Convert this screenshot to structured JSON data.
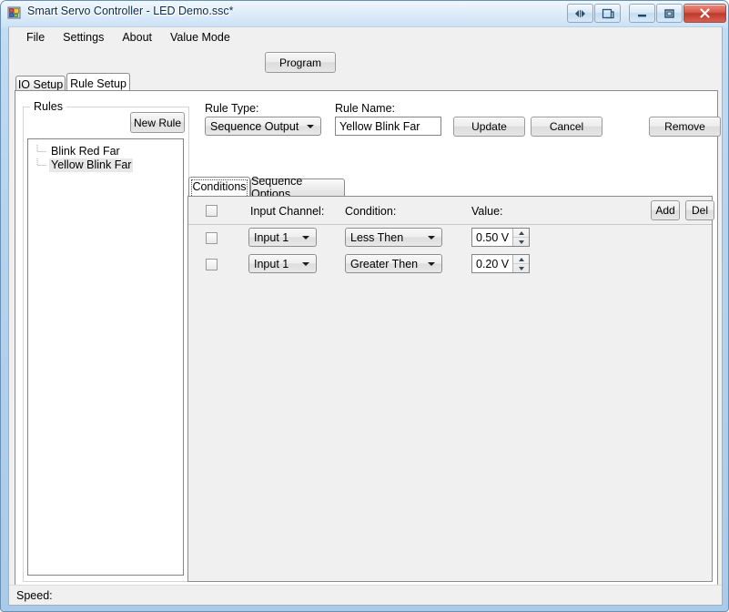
{
  "window": {
    "title": "Smart Servo Controller - LED Demo.ssc*",
    "icon": "app-squares-icon",
    "controls": {
      "nav": "nav-arrows-icon",
      "restore_prev": "restore-window-icon",
      "minimize": "minimize-icon",
      "maximize": "maximize-icon",
      "close": "close-icon"
    }
  },
  "menu": {
    "items": [
      {
        "label": "File"
      },
      {
        "label": "Settings"
      },
      {
        "label": "About"
      },
      {
        "label": "Value Mode"
      }
    ]
  },
  "toolbar": {
    "program_label": "Program"
  },
  "tabs": [
    {
      "label": "IO Setup",
      "active": false
    },
    {
      "label": "Rule Setup",
      "active": true
    }
  ],
  "rules_group": {
    "title": "Rules",
    "new_rule_label": "New Rule",
    "items": [
      {
        "label": "Blink Red Far",
        "selected": false
      },
      {
        "label": "Yellow Blink Far",
        "selected": true
      }
    ]
  },
  "rule_form": {
    "rule_type_label": "Rule Type:",
    "rule_type_value": "Sequence Output",
    "rule_name_label": "Rule Name:",
    "rule_name_value": "Yellow Blink Far",
    "update_label": "Update",
    "cancel_label": "Cancel",
    "remove_label": "Remove"
  },
  "inner_tabs": [
    {
      "label": "Conditions",
      "active": true
    },
    {
      "label": "Sequence Options",
      "active": false
    }
  ],
  "conditions": {
    "headers": {
      "input_channel": "Input Channel:",
      "condition": "Condition:",
      "value": "Value:"
    },
    "add_label": "Add",
    "del_label": "Del",
    "rows": [
      {
        "checked": false,
        "input_channel": "Input 1",
        "condition": "Less Then",
        "value": "0.50 V"
      },
      {
        "checked": false,
        "input_channel": "Input 1",
        "condition": "Greater Then",
        "value": "0.20 V"
      }
    ]
  },
  "statusbar": {
    "speed_label": "Speed:"
  }
}
